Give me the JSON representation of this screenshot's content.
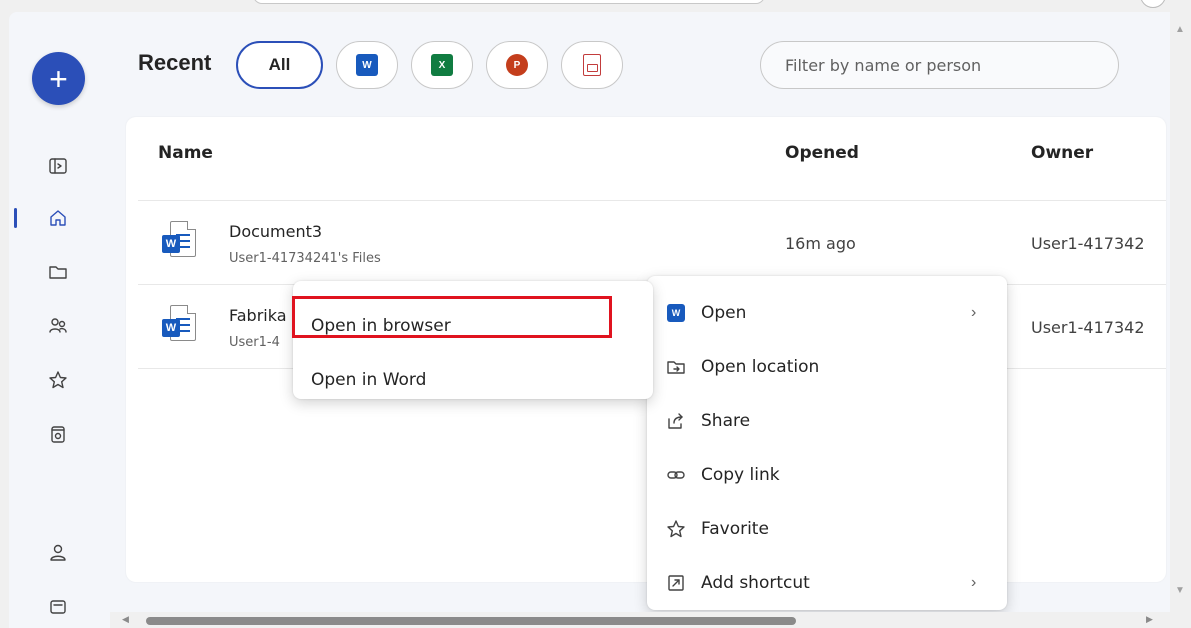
{
  "header": {
    "recent_title": "Recent",
    "filter_all": "All",
    "filter_word": "W",
    "filter_excel": "X",
    "filter_ppt": "P",
    "filter_placeholder": "Filter by name or person"
  },
  "create": {
    "label": "+"
  },
  "nav": {
    "items": [
      "expand-icon",
      "home-icon",
      "folder-icon",
      "people-icon",
      "star-icon",
      "recycle-bin-icon",
      "account-icon",
      "apps-icon"
    ],
    "active": "home-icon"
  },
  "table": {
    "columns": [
      "Name",
      "Opened",
      "Owner"
    ],
    "rows": [
      {
        "name": "Document3",
        "location": "User1-41734241's Files",
        "opened": "16m ago",
        "owner": "User1-417342"
      },
      {
        "name": "Fabrika",
        "location": "User1-4",
        "opened": "",
        "owner": "User1-417342"
      }
    ],
    "doc_badge": "W"
  },
  "context_menu": {
    "items": [
      {
        "label": "Open",
        "icon": "word-icon",
        "has_submenu": true
      },
      {
        "label": "Open location",
        "icon": "open-location-icon",
        "has_submenu": false
      },
      {
        "label": "Share",
        "icon": "share-icon",
        "has_submenu": false
      },
      {
        "label": "Copy link",
        "icon": "link-icon",
        "has_submenu": false
      },
      {
        "label": "Favorite",
        "icon": "star-icon",
        "has_submenu": false
      },
      {
        "label": "Add shortcut",
        "icon": "shortcut-icon",
        "has_submenu": true
      }
    ],
    "chevron": "›"
  },
  "submenu": {
    "items": [
      "Open in browser",
      "Open in Word"
    ],
    "highlighted": "Open in browser"
  },
  "colors": {
    "accent": "#2b4fb8",
    "word": "#185abd",
    "excel": "#107c41",
    "powerpoint": "#c43e1c",
    "highlight_box": "#e0131f"
  }
}
